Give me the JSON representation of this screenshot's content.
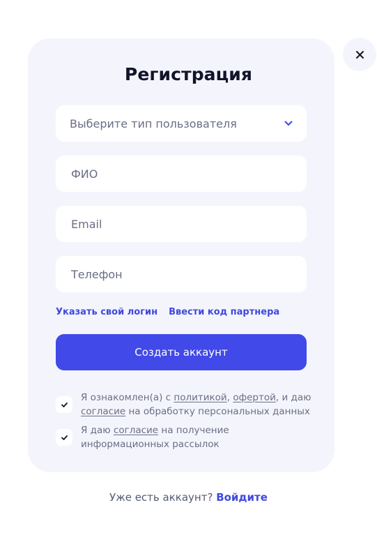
{
  "modal": {
    "title": "Регистрация",
    "close_icon": "close-icon"
  },
  "form": {
    "user_type_placeholder": "Выберите тип пользователя",
    "fio_placeholder": "ФИО",
    "email_placeholder": "Email",
    "phone_placeholder": "Телефон",
    "link_login": "Указать свой логин",
    "link_partner": "Ввести код партнера",
    "submit_label": "Создать аккаунт"
  },
  "consents": {
    "privacy": {
      "checked": true,
      "prefix": "Я ознакомлен(а) с ",
      "policy_link": "политикой",
      "comma": ",",
      "space": " ",
      "offer_link": "офертой",
      "middle": ", и даю ",
      "consent_link": "согласие",
      "suffix": " на обработку персональных данных"
    },
    "newsletter": {
      "checked": true,
      "prefix": "Я даю ",
      "consent_link": "согласие",
      "suffix": " на получение информационных рассылок"
    }
  },
  "footer": {
    "question": "Уже есть аккаунт? ",
    "login_link": "Войдите"
  },
  "colors": {
    "accent": "#4149e8",
    "link": "#3f49dc",
    "card_bg": "#f4f5fc",
    "title": "#13142b",
    "muted": "#6a6e85"
  }
}
